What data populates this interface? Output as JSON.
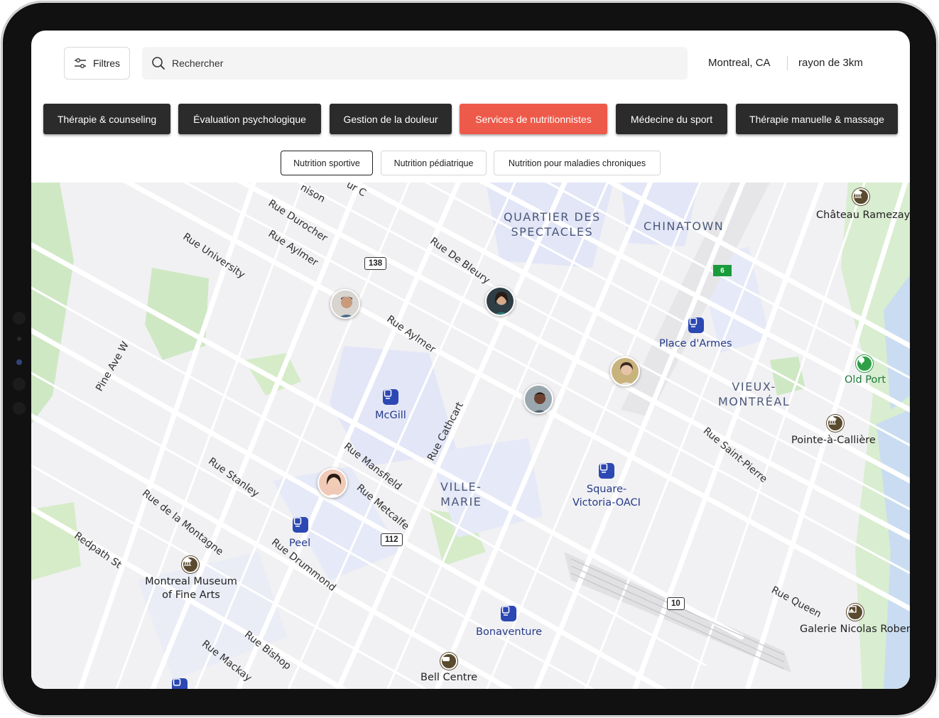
{
  "toolbar": {
    "filters_label": "Filtres",
    "search_placeholder": "Rechercher",
    "location": "Montreal, CA",
    "radius": "rayon de 3km"
  },
  "categories": [
    {
      "label": "Thérapie & counseling",
      "active": false
    },
    {
      "label": "Évaluation psychologique",
      "active": false
    },
    {
      "label": "Gestion de la douleur",
      "active": false
    },
    {
      "label": "Services de nutritionnistes",
      "active": true
    },
    {
      "label": "Médecine du sport",
      "active": false
    },
    {
      "label": "Thérapie manuelle & massage",
      "active": false
    }
  ],
  "subcategories": [
    {
      "label": "Nutrition sportive",
      "active": true
    },
    {
      "label": "Nutrition pédiatrique",
      "active": false
    },
    {
      "label": "Nutrition pour maladies chroniques",
      "active": false
    }
  ],
  "colors": {
    "accent": "#ee5a4a",
    "chip_dark": "#2b2b2b",
    "metro": "#2c48b3"
  },
  "map": {
    "districts": [
      "QUARTIER DES",
      "SPECTACLES",
      "CHINATOWN",
      "VIEUX-",
      "MONTRÉAL",
      "VILLE-",
      "MARIE"
    ],
    "streets": [
      "Rue Durocher",
      "Rue Aylmer",
      "Rue University",
      "Rue De Bleury",
      "Rue Aylmer",
      "Pine Ave W",
      "Rue Mansfield",
      "Rue Cathcart",
      "Rue Metcalfe",
      "Rue Stanley",
      "Rue de la Montagne",
      "Redpath St",
      "Rue Drummond",
      "Rue Bishop",
      "Rue Mackay",
      "Rue Saint-Pierre",
      "Rue Queen",
      "nison",
      "ur C"
    ],
    "metro_stations": [
      "McGill",
      "Place d'Armes",
      "Square-",
      "Victoria-OACI",
      "Peel",
      "Bonaventure"
    ],
    "pois": [
      "Château Ramezay",
      "Pointe-à-Callière",
      "Montreal Museum",
      "of Fine Arts",
      "Bell Centre",
      "Galerie Nicolas Robert"
    ],
    "parks": [
      "Old Port"
    ],
    "route_shields": [
      "138",
      "112",
      "10",
      "6"
    ]
  }
}
